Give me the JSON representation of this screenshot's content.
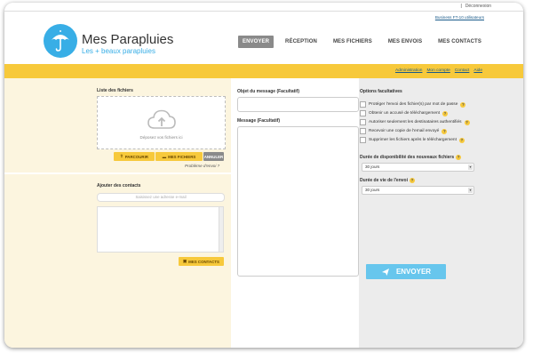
{
  "header": {
    "logout_label": "Déconnexion",
    "user_info": "Business FT-10 utilisateurs",
    "brand": "Mes Parapluies",
    "tagline": "Les + beaux parapluies"
  },
  "nav": {
    "items": [
      {
        "label": "ENVOYER"
      },
      {
        "label": "RÉCEPTION"
      },
      {
        "label": "MES FICHIERS"
      },
      {
        "label": "MES ENVOIS"
      },
      {
        "label": "MES CONTACTS"
      }
    ]
  },
  "sublinks": {
    "admin": "Administration",
    "account": "Mon compte",
    "contact": "Contact",
    "help": "Aide"
  },
  "files": {
    "title": "Liste des fichiers",
    "drop_text": "Déposez vos fichiers ici",
    "browse_label": "PARCOURIR",
    "myfiles_label": "MES FICHIERS",
    "cancel_label": "ANNULER",
    "problem_text": "Problème d'envoi ?"
  },
  "contacts": {
    "title": "Ajouter des contacts",
    "input_placeholder": "Saisissez une adresse e-mail",
    "button_label": "MES CONTACTS"
  },
  "message": {
    "subject_label": "Objet du message (Facultatif)",
    "message_label": "Message (Facultatif)"
  },
  "options": {
    "title": "Options facultatives",
    "items": [
      {
        "label": "Protéger l'envoi des fichier(s) par mot de passe"
      },
      {
        "label": "Obtenir un accusé de téléchargement"
      },
      {
        "label": "Autoriser seulement les destinataires authentifiés"
      },
      {
        "label": "Recevoir une copie de l'email envoyé"
      },
      {
        "label": "Supprimer les fichiers après le téléchargement"
      }
    ],
    "availability_label": "Durée de disponibilité des nouveaux fichiers",
    "availability_value": "30 jours",
    "lifetime_label": "Durée de vie de l'envoi",
    "lifetime_value": "30 jours"
  },
  "send": {
    "label": "ENVOYER"
  },
  "icons": {
    "logo": "umbrella-icon",
    "cloud": "cloud-upload-icon",
    "send": "paper-plane-icon",
    "help": "help-icon",
    "contacts": "contacts-icon",
    "browse": "upload-icon",
    "folder": "folder-icon"
  },
  "colors": {
    "accent_yellow": "#f7c93b",
    "accent_blue": "#38aee6",
    "send_blue": "#67c6ed",
    "nav_active": "#8a8a8a"
  }
}
